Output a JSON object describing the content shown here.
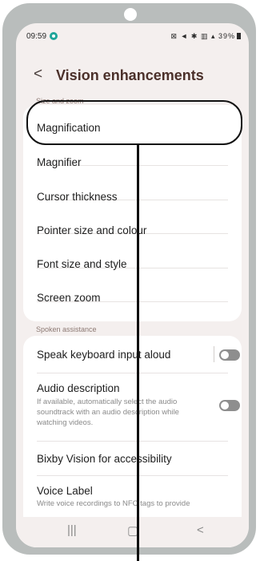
{
  "status_bar": {
    "time": "09:59",
    "right_icons": "⊠ ◄ ✱ ▥ ▴ 39%",
    "battery_percent": "39%"
  },
  "header": {
    "back_symbol": "<",
    "title": "Vision enhancements"
  },
  "section_size_zoom": {
    "label": "Size and zoom",
    "items": [
      "Magnification",
      "Magnifier",
      "Cursor thickness",
      "Pointer size and colour",
      "Font size and style",
      "Screen zoom"
    ]
  },
  "section_spoken": {
    "label": "Spoken assistance",
    "speak_keyboard": {
      "label": "Speak keyboard input aloud",
      "toggle_on": false
    },
    "audio_description": {
      "label": "Audio description",
      "description": "If available, automatically select the audio soundtrack with an audio description while watching videos.",
      "toggle_on": false
    },
    "bixby_vision": {
      "label": "Bixby Vision for accessibility"
    },
    "voice_label": {
      "label": "Voice Label",
      "description": "Write voice recordings to NFC tags to provide"
    }
  },
  "nav_bar": {
    "recents_symbol": "|||",
    "home_symbol": "▢",
    "back_symbol": "<"
  },
  "colors": {
    "screen_background": "#f4efee",
    "card_background": "#ffffff",
    "title_color": "#4b302a",
    "toggle_off": "#8e8e8e",
    "phone_frame": "#b9bdbc"
  }
}
